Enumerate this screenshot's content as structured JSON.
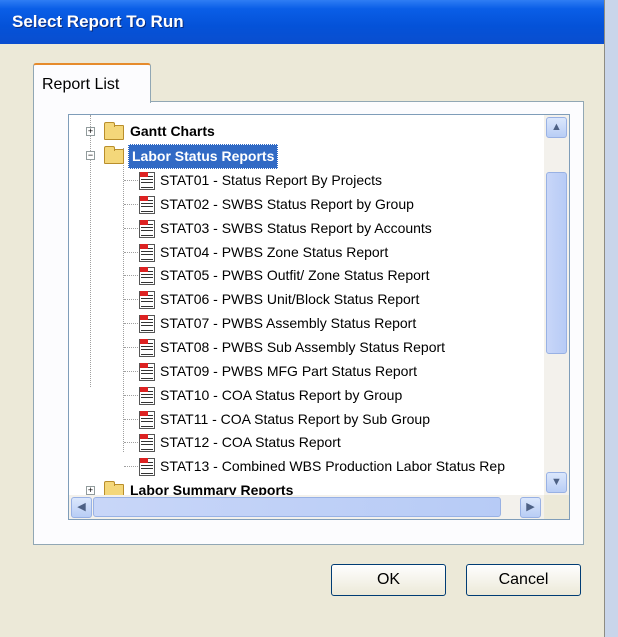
{
  "dialog": {
    "title": "Select Report To Run"
  },
  "tabs": [
    {
      "label": "Report List"
    }
  ],
  "tree": {
    "folders": [
      {
        "label": "Gantt Charts",
        "expanded": false
      },
      {
        "label": "Labor  Status Reports",
        "expanded": true,
        "selected": true
      },
      {
        "label": "Labor  Summary Reports",
        "expanded": false
      }
    ],
    "reports": [
      "STAT01 - Status Report By Projects",
      "STAT02 - SWBS Status Report by Group",
      "STAT03 - SWBS Status Report by Accounts",
      "STAT04 - PWBS Zone Status Report",
      "STAT05 - PWBS Outfit/ Zone Status Report",
      "STAT06 - PWBS Unit/Block Status Report",
      "STAT07 - PWBS Assembly Status Report",
      "STAT08 - PWBS Sub Assembly Status Report",
      "STAT09 - PWBS MFG Part Status Report",
      "STAT10 - COA Status Report by Group",
      "STAT11 - COA Status Report by Sub Group",
      "STAT12 - COA Status Report",
      "STAT13 - Combined WBS Production Labor Status Rep"
    ],
    "icons": {
      "folder": "folder-icon",
      "report": "report-icon",
      "expand": "plus-icon",
      "collapse": "minus-icon"
    }
  },
  "buttons": {
    "ok": "OK",
    "cancel": "Cancel"
  },
  "colors": {
    "title_bar": "#0452d8",
    "selection": "#316ac5",
    "dialog_bg": "#ece9d8"
  }
}
